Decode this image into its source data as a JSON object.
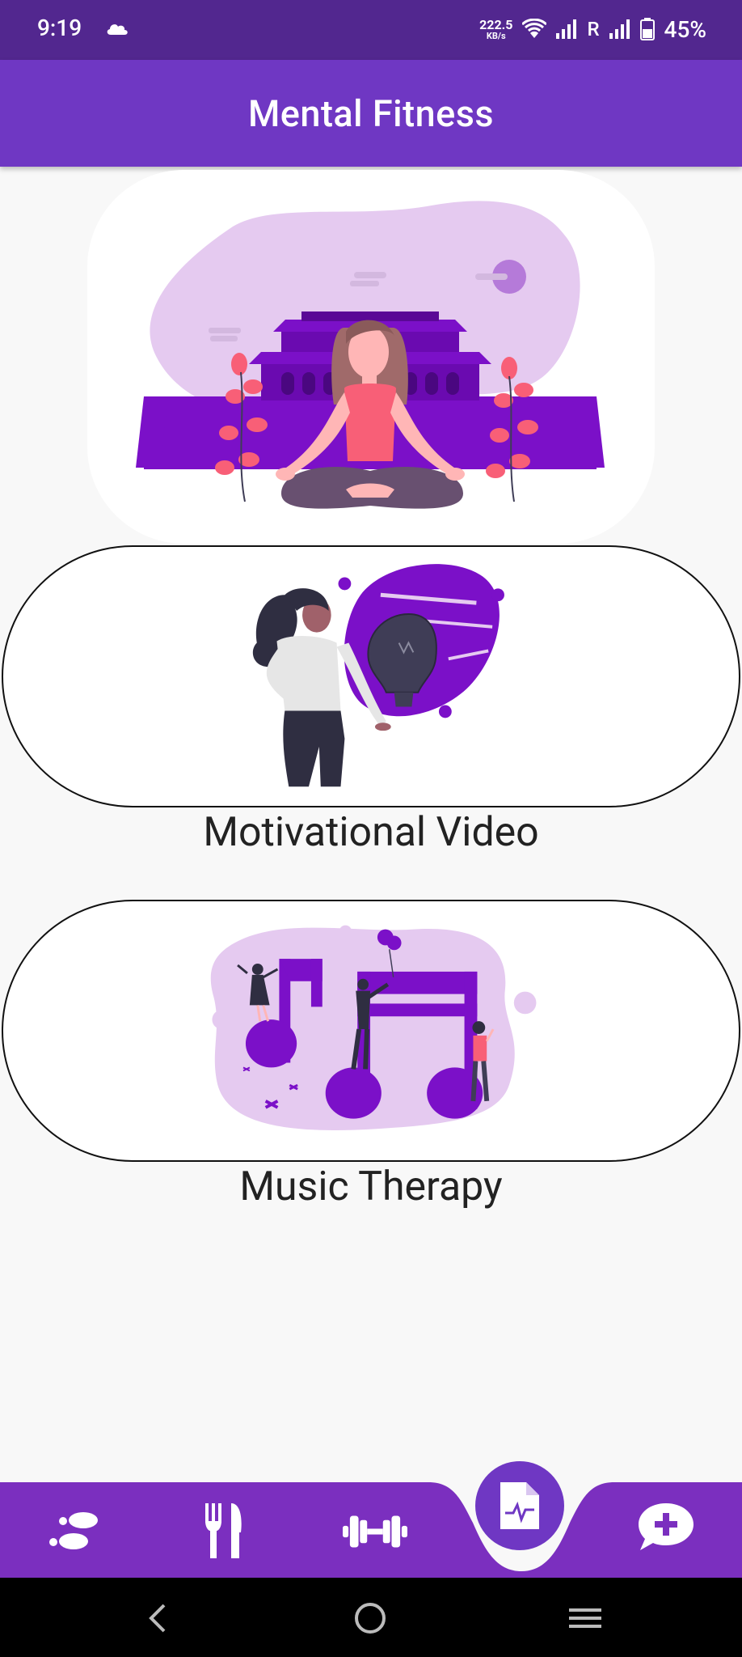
{
  "status_bar": {
    "time": "9:19",
    "net_speed_value": "222.5",
    "net_speed_unit": "KB/s",
    "roaming": "R",
    "battery": "45%",
    "icons": [
      "cloud-icon",
      "wifi-icon",
      "signal-icon",
      "signal-icon-2",
      "battery-icon"
    ]
  },
  "app_bar": {
    "title": "Mental Fitness"
  },
  "hero": {
    "illustration": "meditation-illustration"
  },
  "options": [
    {
      "label": "Motivational Video",
      "illustration": "lightbulb-woman-illustration"
    },
    {
      "label": "Music Therapy",
      "illustration": "music-notes-illustration"
    }
  ],
  "bottom_nav": {
    "items": [
      "footsteps-icon",
      "fork-knife-icon",
      "dumbbell-icon",
      "health-report-icon",
      "chat-plus-icon"
    ],
    "active": "health-report-icon"
  },
  "system_nav": {
    "buttons": [
      "back-icon",
      "home-icon",
      "menu-icon"
    ]
  },
  "colors": {
    "primary": "#6f37c3",
    "status_bar": "#52278f",
    "accent_purple": "#7b10c8",
    "pink": "#f85f77"
  }
}
